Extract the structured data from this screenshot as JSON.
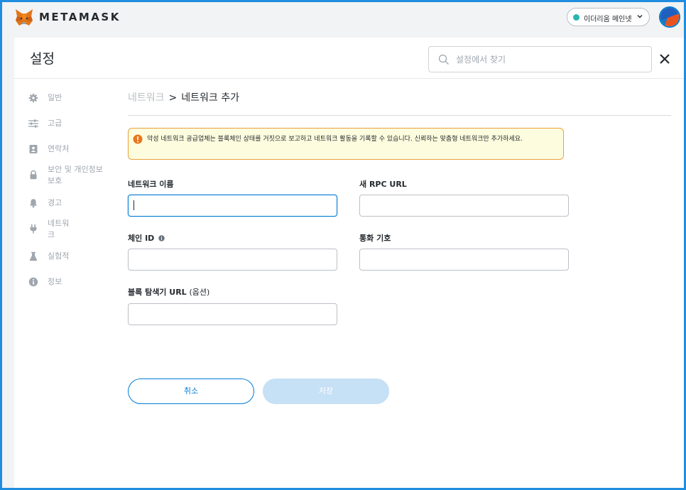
{
  "brand": {
    "name": "METAMASK"
  },
  "network": {
    "label": "이더리움 메인넷",
    "dot_color": "#29b6af"
  },
  "header": {
    "title": "설정",
    "search_placeholder": "설정에서 찾기"
  },
  "sidebar": {
    "items": [
      {
        "label": "일반",
        "icon": "gear-icon"
      },
      {
        "label": "고급",
        "icon": "sliders-icon"
      },
      {
        "label": "연락처",
        "icon": "contact-book-icon"
      },
      {
        "label": "보안 및 개인정보 보호",
        "icon": "lock-icon"
      },
      {
        "label": "경고",
        "icon": "bell-icon"
      },
      {
        "label": "네트워크",
        "icon": "plug-icon"
      },
      {
        "label": "실험적",
        "icon": "flask-icon"
      },
      {
        "label": "정보",
        "icon": "info-icon"
      }
    ]
  },
  "breadcrumb": {
    "root": "네트워크",
    "separator": ">",
    "current": "네트워크 추가"
  },
  "warning": {
    "text": "악성 네트워크 공급업체는 블록체인 상태를 거짓으로 보고하고 네트워크 활동을 기록할 수 있습니다. 신뢰하는 맞춤형 네트워크만 추가하세요.",
    "color": "#e6a23c"
  },
  "form": {
    "network_name": {
      "label": "네트워크 이름",
      "value": ""
    },
    "rpc_url": {
      "label": "새 RPC URL",
      "value": ""
    },
    "chain_id": {
      "label": "체인 ID",
      "value": ""
    },
    "currency_symbol": {
      "label": "통화 기호",
      "value": ""
    },
    "explorer_url": {
      "label": "블록 탐색기 URL",
      "label_suffix": "(옵션)",
      "value": ""
    }
  },
  "buttons": {
    "cancel": "취소",
    "save": "저장"
  },
  "colors": {
    "accent": "#037dd6",
    "frame": "#1f8de0"
  }
}
